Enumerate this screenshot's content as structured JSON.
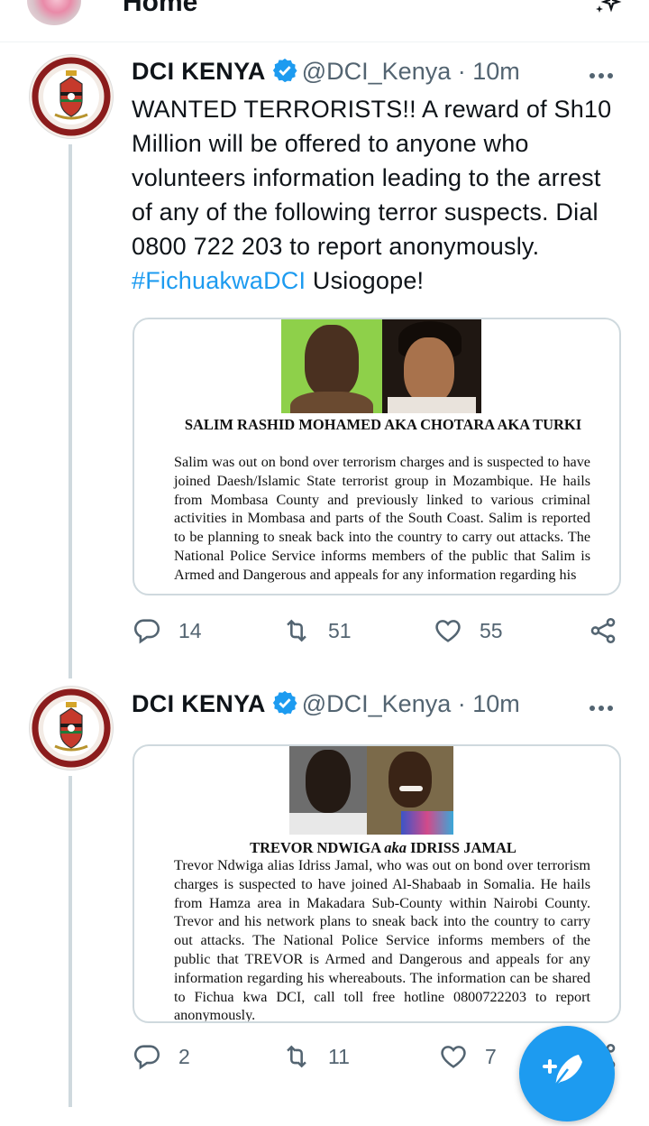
{
  "topbar": {
    "title": "Home",
    "sparkle_icon": "sparkle-icon"
  },
  "colors": {
    "accent": "#1d9bf0",
    "secondary_text": "#536471",
    "border": "#cfd9de"
  },
  "tweets": [
    {
      "name": "DCI KENYA",
      "handle": "@DCI_Kenya",
      "separator": "·",
      "time": "10m",
      "text_before": "WANTED TERRORISTS!! A reward of Sh10 Million will be offered to anyone who volunteers information leading to the arrest of any of the following terror suspects. Dial 0800 722 203 to report anonymously.",
      "hashtag": "#FichuakwaDCI",
      "text_after": " Usiogope!",
      "media": {
        "title": "SALIM RASHID MOHAMED AKA CHOTARA AKA TURKI",
        "body": "Salim was out on bond over terrorism charges and is suspected to have joined Daesh/Islamic State terrorist group in Mozambique. He hails from Mombasa County and previously linked to various criminal activities in Mombasa and parts of the South Coast. Salim is reported to be planning to sneak back into the country to carry out attacks. The National Police Service informs members of the public that Salim is Armed and Dangerous and appeals for any information regarding his"
      },
      "replies": "14",
      "retweets": "51",
      "likes": "55"
    },
    {
      "name": "DCI KENYA",
      "handle": "@DCI_Kenya",
      "separator": "·",
      "time": "10m",
      "media": {
        "title_part1": "TREVOR NDWIGA ",
        "title_part2": "aka",
        "title_part3": " IDRISS JAMAL",
        "body": "Trevor Ndwiga alias Idriss Jamal, who was out on bond over terrorism charges is suspected to have joined Al-Shabaab in Somalia. He hails from Hamza area in Makadara Sub-County within Nairobi County. Trevor and his network plans to sneak back into the country to carry out attacks.  The National Police Service informs members of the public that TREVOR is Armed and Dangerous and appeals for any information regarding his whereabouts. The information can be shared to Fichua kwa DCI, call toll free hotline 0800722203 to report anonymously."
      },
      "replies": "2",
      "retweets": "11",
      "likes": "7"
    }
  ],
  "fab": {
    "icon": "compose-feather-icon"
  }
}
